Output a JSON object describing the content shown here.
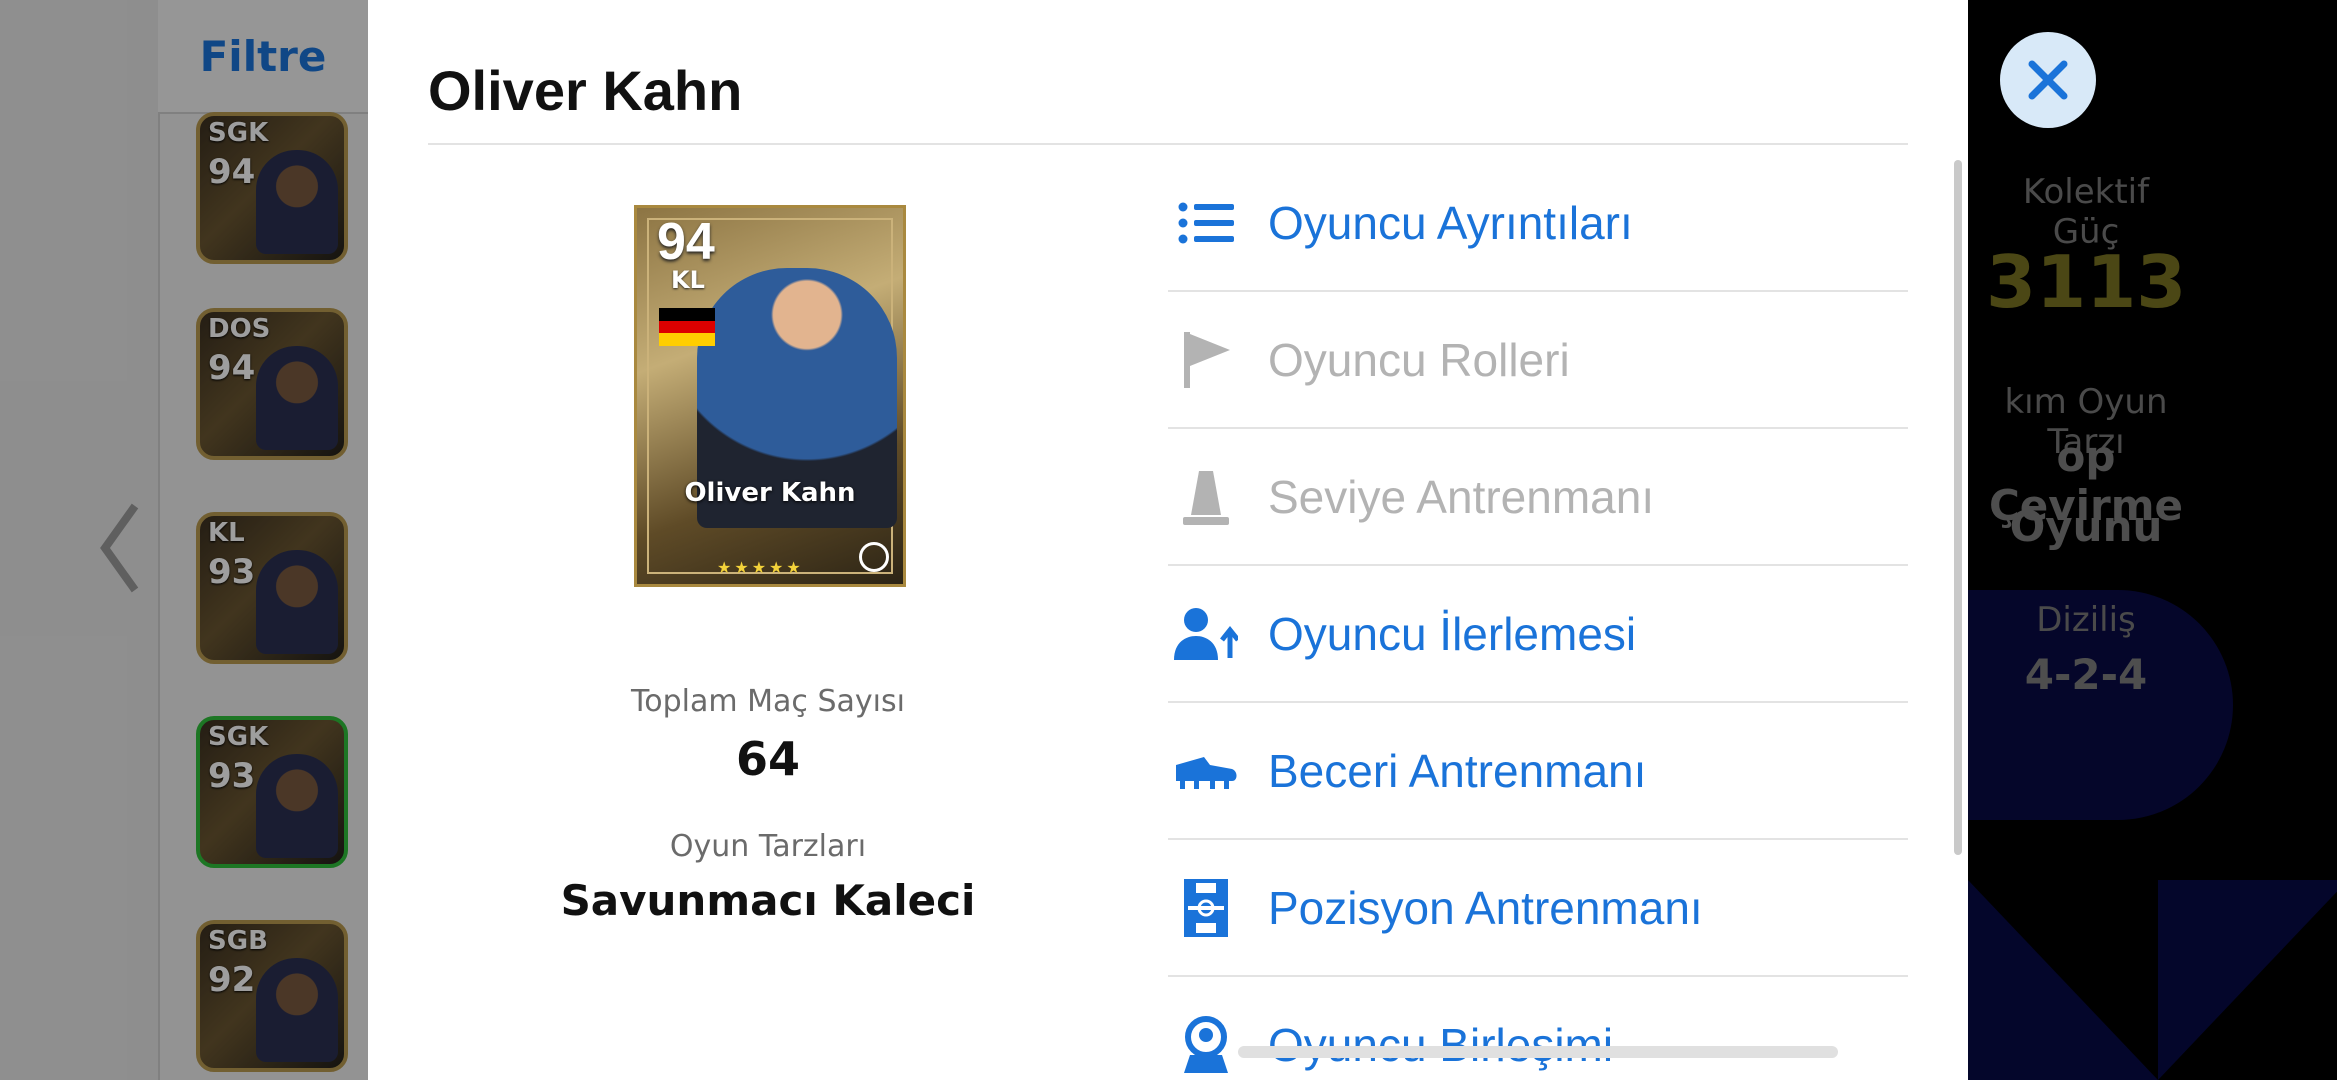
{
  "background_left": {
    "filter_label": "Filtre",
    "cards": [
      {
        "position": "SGK",
        "rating": "94"
      },
      {
        "position": "DOS",
        "rating": "94"
      },
      {
        "position": "KL",
        "rating": "93"
      },
      {
        "position": "SGK",
        "rating": "93"
      },
      {
        "position": "SGB",
        "rating": "92"
      }
    ]
  },
  "background_right": {
    "collective_label": "Kolektif Güç",
    "collective_value": "3113",
    "team_style_label": "kım Oyun Tarzı",
    "team_style_value_1": "op Çevirme",
    "team_style_value_2": "Oyunu",
    "formation_label": "Diziliş",
    "formation_value": "4-2-4"
  },
  "modal": {
    "title": "Oliver Kahn",
    "card": {
      "rating": "94",
      "position": "KL",
      "name": "Oliver Kahn",
      "stars": "★★★★★",
      "flag_colors": [
        "#000000",
        "#dd0000",
        "#ffce00"
      ]
    },
    "stats": {
      "matches_label": "Toplam Maç Sayısı",
      "matches_value": "64",
      "playstyle_label": "Oyun Tarzları",
      "playstyle_value": "Savunmacı Kaleci"
    },
    "menu": [
      {
        "label": "Oyuncu Ayrıntıları",
        "icon": "list-icon",
        "enabled": true
      },
      {
        "label": "Oyuncu Rolleri",
        "icon": "flag-icon",
        "enabled": false
      },
      {
        "label": "Seviye Antrenmanı",
        "icon": "cone-icon",
        "enabled": false
      },
      {
        "label": "Oyuncu İlerlemesi",
        "icon": "user-progress-icon",
        "enabled": true
      },
      {
        "label": "Beceri Antrenmanı",
        "icon": "boot-icon",
        "enabled": true
      },
      {
        "label": "Pozisyon Antrenmanı",
        "icon": "pitch-icon",
        "enabled": true
      },
      {
        "label": "Oyuncu Birleşimi",
        "icon": "merge-icon",
        "enabled": true
      }
    ]
  },
  "colors": {
    "accent": "#1a73d9",
    "disabled": "#b3b3b3"
  }
}
